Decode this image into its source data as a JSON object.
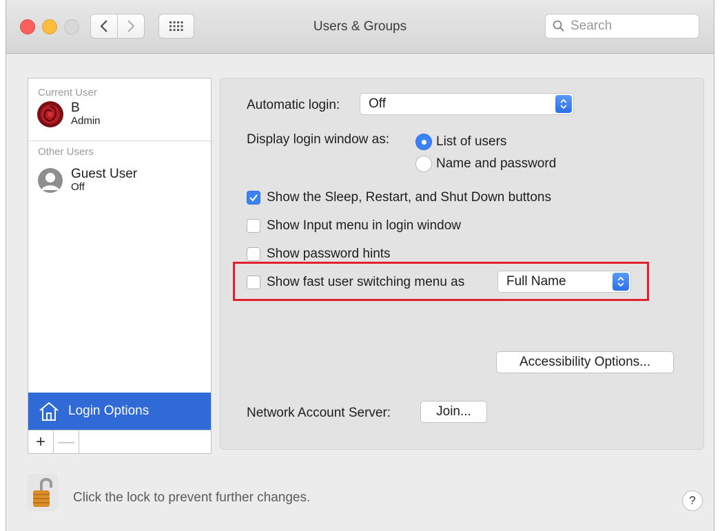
{
  "window": {
    "title": "Users & Groups",
    "search_placeholder": "Search"
  },
  "sidebar": {
    "current_user_header": "Current User",
    "current_user": {
      "name": "B",
      "role": "Admin"
    },
    "other_users_header": "Other Users",
    "other_users": [
      {
        "name": "Guest User",
        "status": "Off"
      }
    ],
    "login_options_label": "Login Options",
    "add_label": "+",
    "remove_label": "—"
  },
  "main": {
    "automatic_login_label": "Automatic login:",
    "automatic_login_value": "Off",
    "display_login_label": "Display login window as:",
    "display_options": [
      {
        "label": "List of users",
        "selected": true
      },
      {
        "label": "Name and password",
        "selected": false
      }
    ],
    "checkboxes": [
      {
        "label": "Show the Sleep, Restart, and Shut Down buttons",
        "checked": true
      },
      {
        "label": "Show Input menu in login window",
        "checked": false
      },
      {
        "label": "Show password hints",
        "checked": false
      },
      {
        "label": "Show fast user switching menu as",
        "checked": false
      }
    ],
    "fast_user_switching_value": "Full Name",
    "accessibility_button": "Accessibility Options...",
    "network_account_label": "Network Account Server:",
    "join_button": "Join..."
  },
  "footer": {
    "lock_text": "Click the lock to prevent further changes.",
    "help_label": "?"
  },
  "colors": {
    "accent": "#3b82f6",
    "selection": "#2f6ad6",
    "highlight_box": "#e0202a"
  }
}
